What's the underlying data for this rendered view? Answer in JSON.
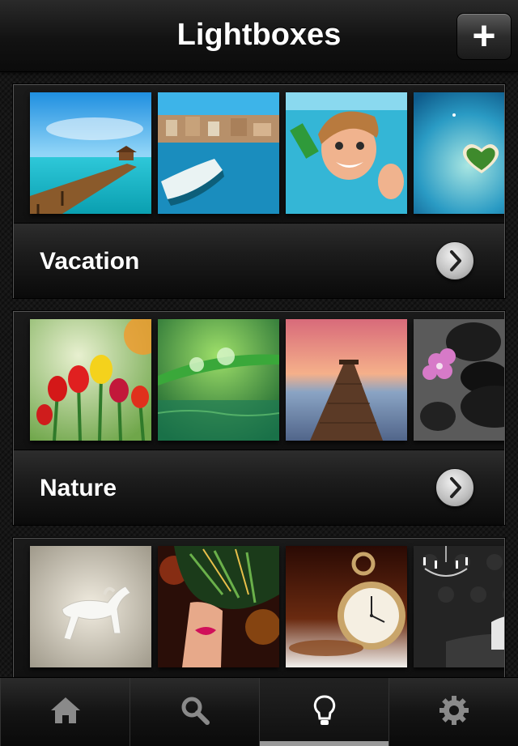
{
  "header": {
    "title": "Lightboxes",
    "add_label": "+"
  },
  "lightboxes": [
    {
      "name": "Vacation",
      "photos": [
        "tropical-pier-photo",
        "harbor-boat-photo",
        "swimming-child-photo",
        "heart-island-photo"
      ]
    },
    {
      "name": "Nature",
      "photos": [
        "tulips-photo",
        "water-drop-leaf-photo",
        "sunset-pier-photo",
        "zen-stones-orchid-photo"
      ]
    },
    {
      "name": "",
      "photos": [
        "white-horse-photo",
        "feather-portrait-photo",
        "pocket-watch-photo",
        "chandelier-room-photo"
      ]
    }
  ],
  "tabbar": {
    "tabs": [
      {
        "icon": "home-icon"
      },
      {
        "icon": "search-icon"
      },
      {
        "icon": "lightbulb-icon",
        "active": true
      },
      {
        "icon": "gear-icon"
      }
    ]
  }
}
